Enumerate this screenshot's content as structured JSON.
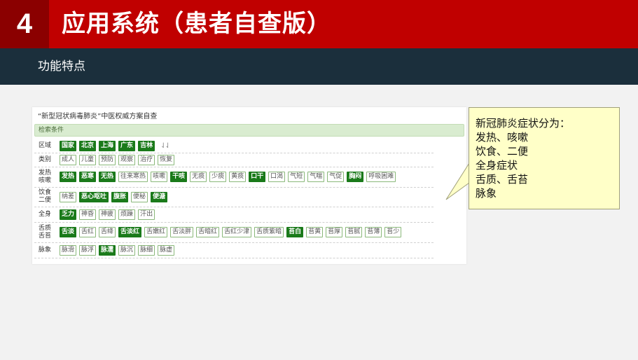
{
  "header": {
    "number": "4",
    "title": "应用系统（患者自查版）"
  },
  "subheader": {
    "title": "功能特点"
  },
  "panel": {
    "title": "“新型冠状病毒肺炎”中医权威方案自查",
    "section": "检索条件",
    "filters": [
      {
        "label": "区域",
        "chips": [
          {
            "text": "国家",
            "selected": true
          },
          {
            "text": "北京",
            "selected": true
          },
          {
            "text": "上海",
            "selected": true
          },
          {
            "text": "广东",
            "selected": true
          },
          {
            "text": "吉林",
            "selected": true
          }
        ]
      },
      {
        "label": "类别",
        "chips": [
          {
            "text": "成人",
            "selected": false
          },
          {
            "text": "儿童",
            "selected": false
          },
          {
            "text": "预防",
            "selected": false
          },
          {
            "text": "观察",
            "selected": false
          },
          {
            "text": "治疗",
            "selected": false
          },
          {
            "text": "恢复",
            "selected": false
          }
        ]
      },
      {
        "label": "发热咳嗽",
        "chips": [
          {
            "text": "发热",
            "selected": true
          },
          {
            "text": "恶寒",
            "selected": true
          },
          {
            "text": "无热",
            "selected": true
          },
          {
            "text": "往来寒热",
            "selected": false
          },
          {
            "text": "咳嗽",
            "selected": false
          },
          {
            "text": "干咳",
            "selected": true
          },
          {
            "text": "无痰",
            "selected": false
          },
          {
            "text": "少痰",
            "selected": false
          },
          {
            "text": "黄痰",
            "selected": false
          },
          {
            "text": "口干",
            "selected": true
          },
          {
            "text": "口渴",
            "selected": false
          },
          {
            "text": "气短",
            "selected": false
          },
          {
            "text": "气喘",
            "selected": false
          },
          {
            "text": "气促",
            "selected": false
          },
          {
            "text": "胸闷",
            "selected": true
          },
          {
            "text": "呼吸困难",
            "selected": false
          }
        ]
      },
      {
        "label": "饮食二便",
        "chips": [
          {
            "text": "纳差",
            "selected": false
          },
          {
            "text": "恶心呕吐",
            "selected": true
          },
          {
            "text": "腹胀",
            "selected": true
          },
          {
            "text": "便秘",
            "selected": false
          },
          {
            "text": "便溏",
            "selected": true
          }
        ]
      },
      {
        "label": "全身",
        "chips": [
          {
            "text": "乏力",
            "selected": true
          },
          {
            "text": "神昏",
            "selected": false
          },
          {
            "text": "神疲",
            "selected": false
          },
          {
            "text": "烦躁",
            "selected": false
          },
          {
            "text": "汗出",
            "selected": false
          }
        ]
      },
      {
        "label": "舌质舌苔",
        "chips": [
          {
            "text": "舌淡",
            "selected": true
          },
          {
            "text": "舌红",
            "selected": false
          },
          {
            "text": "舌绛",
            "selected": false
          },
          {
            "text": "舌淡红",
            "selected": true
          },
          {
            "text": "舌嫩红",
            "selected": false
          },
          {
            "text": "舌淡胖",
            "selected": false
          },
          {
            "text": "舌暗红",
            "selected": false
          },
          {
            "text": "舌红少津",
            "selected": false
          },
          {
            "text": "舌质紫暗",
            "selected": false
          },
          {
            "text": "苔白",
            "selected": true
          },
          {
            "text": "苔黄",
            "selected": false
          },
          {
            "text": "苔厚",
            "selected": false
          },
          {
            "text": "苔腻",
            "selected": false
          },
          {
            "text": "苔薄",
            "selected": false
          },
          {
            "text": "苔少",
            "selected": false
          }
        ]
      },
      {
        "label": "脉象",
        "chips": [
          {
            "text": "脉滑",
            "selected": false
          },
          {
            "text": "脉浮",
            "selected": false
          },
          {
            "text": "脉濡",
            "selected": true
          },
          {
            "text": "脉沉",
            "selected": false
          },
          {
            "text": "脉细",
            "selected": false
          },
          {
            "text": "脉虚",
            "selected": false
          }
        ]
      }
    ]
  },
  "callout": {
    "lines": [
      "新冠肺炎症状分为：",
      "发热、咳嗽",
      "饮食、二便",
      "全身症状",
      "舌质、舌苔",
      "脉象"
    ]
  },
  "colors": {
    "header_red": "#c00000",
    "number_box": "#8b0000",
    "subheader": "#1b2f3c",
    "chip_selected": "#1a7a1a",
    "callout_bg": "#ffffc8"
  },
  "icons": {
    "sort": "sort-arrows-icon"
  }
}
